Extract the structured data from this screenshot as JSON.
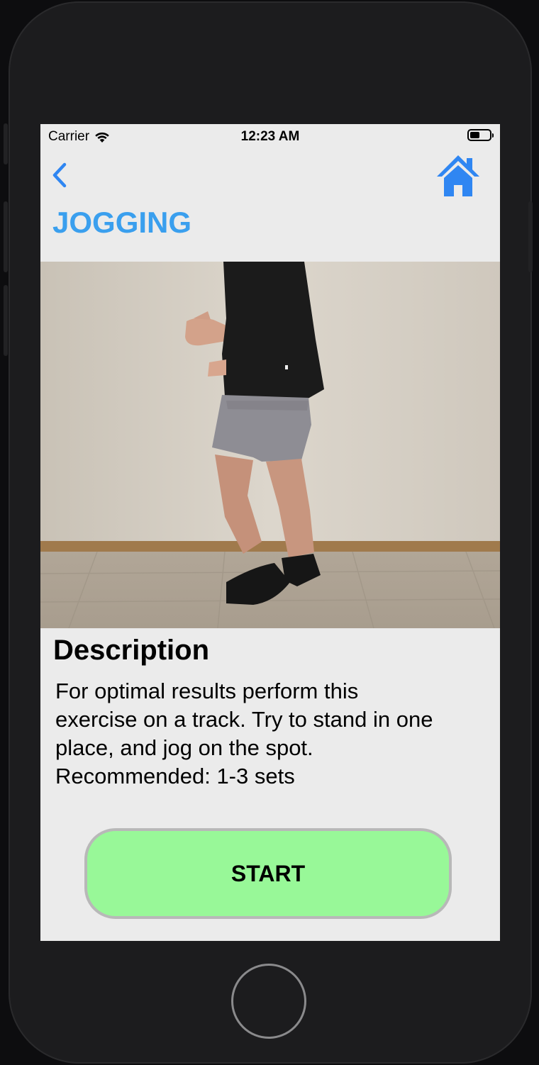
{
  "status_bar": {
    "carrier": "Carrier",
    "time": "12:23 AM",
    "battery_level": 0.5
  },
  "nav": {
    "back_icon": "chevron-left-icon",
    "home_icon": "house-icon"
  },
  "page": {
    "title": "JOGGING"
  },
  "description": {
    "heading": "Description",
    "lines": [
      "For optimal results perform this",
      "exercise on a track. Try to stand in one",
      "place, and jog on the spot.",
      "Recommended: 1-3 sets"
    ]
  },
  "start_button": {
    "label": "START"
  },
  "colors": {
    "accent": "#3a9fee",
    "back_icon": "#2f86f2",
    "start_button": "#98f898",
    "screen_background": "#ebebeb"
  }
}
